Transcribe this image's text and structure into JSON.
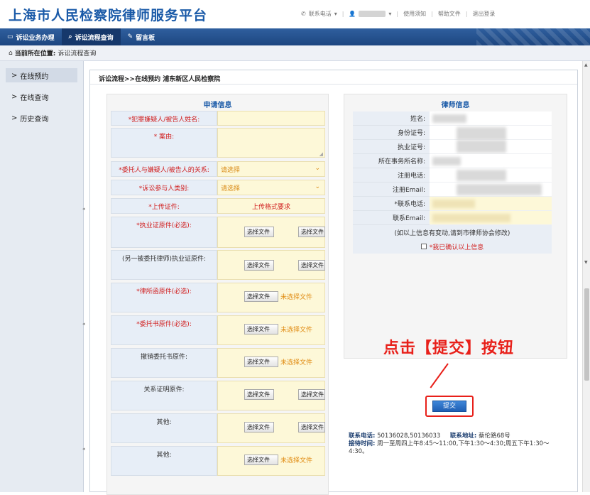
{
  "header": {
    "title": "上海市人民检察院律师服务平台"
  },
  "topbar": {
    "phone_label": "联系电话",
    "help": "使用须知",
    "help_docs": "帮助文件",
    "logout": "退出登录"
  },
  "nav": {
    "items": [
      {
        "label": "诉讼业务办理"
      },
      {
        "label": "诉讼流程查询"
      },
      {
        "label": "留言板"
      }
    ]
  },
  "breadcrumb": {
    "label": "当前所在位置:",
    "value": "诉讼流程查询"
  },
  "sidebar": {
    "items": [
      {
        "label": "在线预约"
      },
      {
        "label": "在线查询"
      },
      {
        "label": "历史查询"
      }
    ]
  },
  "main": {
    "title": "诉讼流程>>在线预约 浦东新区人民检察院"
  },
  "application": {
    "title": "申请信息",
    "suspect_name": "*犯罪嫌疑人/被告人姓名:",
    "case_reason": "* 案由:",
    "relation": {
      "label": "*委托人与嫌疑人/被告人的关系:",
      "value": "请选择"
    },
    "participant": {
      "label": "*诉讼参与人类别:",
      "value": "请选择"
    },
    "upload": {
      "label": "*上传证件:",
      "value": "上传格式要求"
    },
    "choose_file": "选择文件",
    "no_file": "未选择文件",
    "license": "*执业证原件(必选):",
    "other_license": "(另一被委托律师)执业证原件:",
    "firm_letter": "*律所函原件(必选):",
    "power_of_attorney": "*委托书原件(必选):",
    "revoke": "撤销委托书原件:",
    "relation_proof": "关系证明原件:",
    "other1": "其他:",
    "other2": "其他:"
  },
  "lawyer": {
    "title": "律师信息",
    "fields": [
      "姓名:",
      "身份证号:",
      "执业证号:",
      "所在事务所名称:",
      "注册电话:",
      "注册Email:",
      "*联系电话:",
      "联系Email:"
    ],
    "note": "(如以上信息有变动,请到市律师协会修改)",
    "confirm": "*我已确认以上信息"
  },
  "annotation": "点击【提交】按钮",
  "submit_label": "提交",
  "contact": {
    "phone_label": "联系电话:",
    "phone": "50136028,50136033",
    "addr_label": "联系地址:",
    "addr": "蔡伦路68号",
    "time_label": "接待时间:",
    "time": "周一至周四上午8:45～11:00,下午1:30～4:30;周五下午1:30～4:30。"
  }
}
